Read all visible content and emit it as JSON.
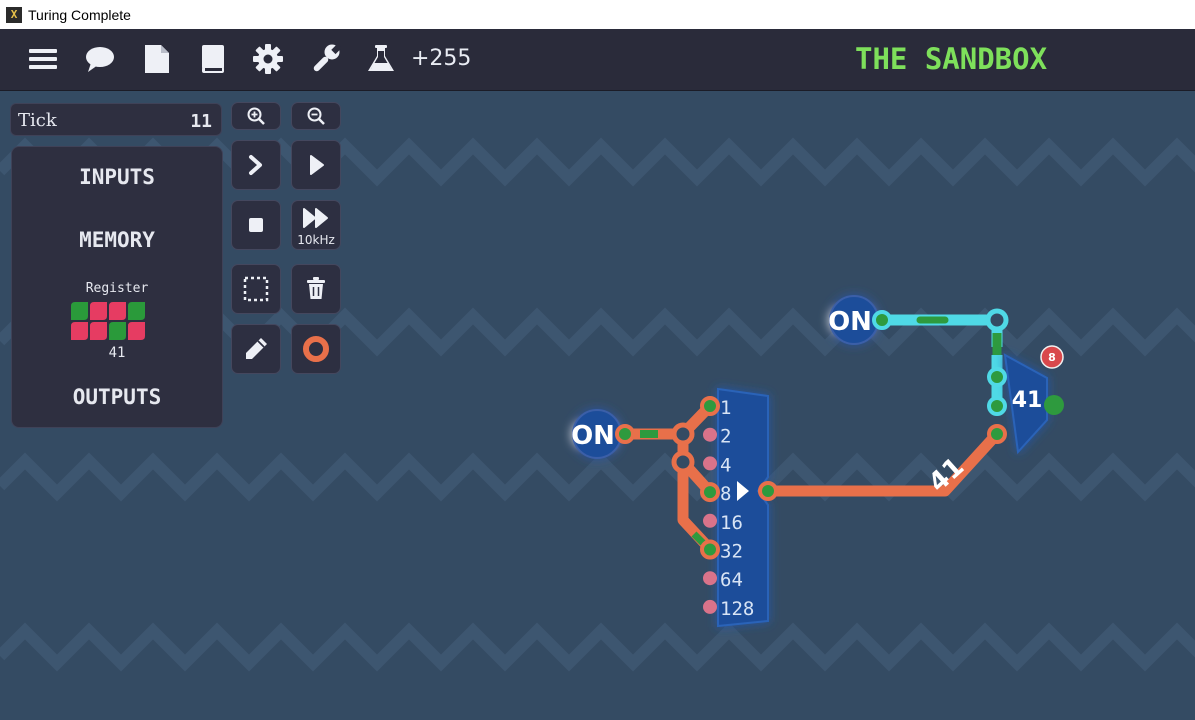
{
  "window": {
    "title": "Turing Complete"
  },
  "topbar": {
    "icons": [
      "menu-icon",
      "chat-icon",
      "document-icon",
      "book-icon",
      "gear-icon",
      "wrench-icon",
      "flask-icon"
    ],
    "score": "+255",
    "level_title": "THE SANDBOX"
  },
  "tick": {
    "label": "Tick",
    "value": "11"
  },
  "components": {
    "inputs": "INPUTS",
    "memory": "MEMORY",
    "register_label": "Register",
    "register_value": "41",
    "register_bits": [
      0,
      1,
      1,
      0,
      1,
      1,
      0,
      1
    ],
    "outputs": "OUTPUTS"
  },
  "controls": {
    "frequency": "10kHz"
  },
  "circuit": {
    "switch_top": "ON",
    "switch_left": "ON",
    "splitter_labels": [
      "1",
      "2",
      "4",
      "8",
      "16",
      "32",
      "64",
      "128"
    ],
    "bus_value": "41",
    "output_value": "41",
    "width_badge": "8"
  },
  "colors": {
    "on_bit": "#e63c62",
    "off_bit": "#2a9a3a",
    "wire_orange": "#e8704a",
    "wire_cyan": "#4fd9e6",
    "wire_green": "#2e9a3e",
    "accent_green": "#7ee05b",
    "component_blue": "#1f4e9a"
  }
}
